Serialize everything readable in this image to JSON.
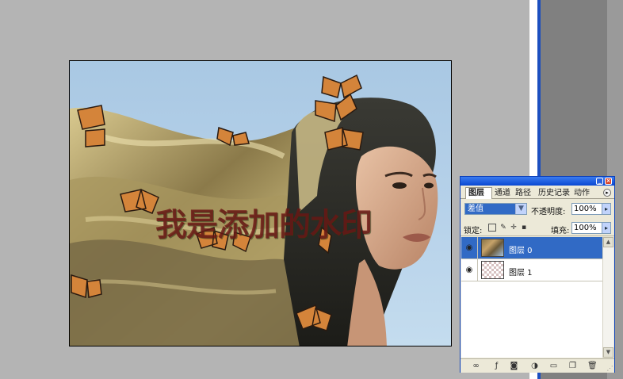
{
  "canvas": {
    "watermark_text": "我是添加的水印",
    "sky_color": "#b0cde6"
  },
  "layers_panel": {
    "tabs": [
      "图层",
      "通道",
      "路径",
      "历史记录",
      "动作"
    ],
    "active_tab": "图层",
    "blend_mode": "差值",
    "opacity_label": "不透明度:",
    "opacity_value": "100%",
    "lock_label": "锁定:",
    "fill_label": "填充:",
    "fill_value": "100%",
    "layers": [
      {
        "name": "图层 0",
        "selected": true,
        "visible": true,
        "thumbnail": "photo"
      },
      {
        "name": "图层 1",
        "selected": false,
        "visible": true,
        "thumbnail": "transparent"
      }
    ],
    "colors": {
      "selection": "#316ac5",
      "titlebar": "#0a48d2",
      "panel_bg": "#ece9d8"
    },
    "bottom_icons": [
      "link-icon",
      "fx-style-icon",
      "mask-icon",
      "adjustment-icon",
      "group-folder-icon",
      "new-layer-icon",
      "trash-icon"
    ]
  }
}
